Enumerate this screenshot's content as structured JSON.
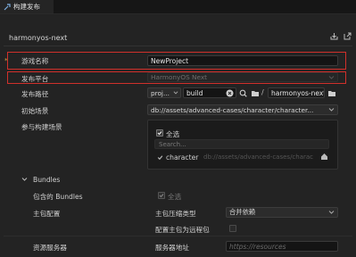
{
  "tab": {
    "label": "构建发布",
    "icon": "build-icon"
  },
  "header": {
    "title": "harmonyos-next"
  },
  "form": {
    "game_name": {
      "label": "游戏名称",
      "required_marker": "*",
      "value": "NewProject"
    },
    "platform": {
      "label": "发布平台",
      "value": "HarmonyOS Next"
    },
    "build_path": {
      "label": "发布路径",
      "prefix": "proj...",
      "value": "build",
      "folder": "harmonyos-next"
    },
    "initial_scene": {
      "label": "初始场景",
      "value": "db://assets/advanced-cases/character/character..."
    },
    "scenes": {
      "label": "参与构建场景",
      "select_all": "全选",
      "search_placeholder": "Search...",
      "items": [
        {
          "name": "character",
          "path": "db://assets/advanced-cases/charac"
        }
      ]
    }
  },
  "bundles": {
    "title": "Bundles",
    "include_label": "包含的 Bundles",
    "include_all": "全选",
    "main_config_label": "主包配置",
    "compression_label": "主包压缩类型",
    "compression_value": "合并依赖",
    "remote_label": "配置主包为远程包",
    "resource_server_label": "资源服务器",
    "server_address_label": "服务器地址",
    "server_placeholder": "https://resources"
  }
}
